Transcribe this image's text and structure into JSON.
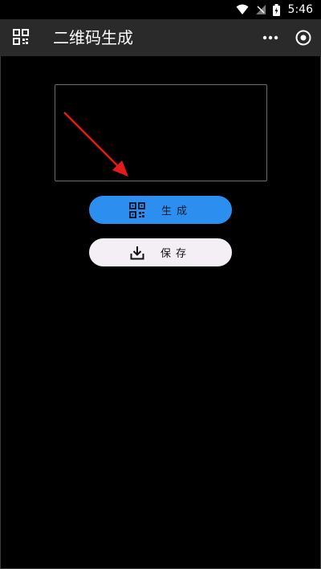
{
  "status_bar": {
    "time": "5:46",
    "icons": [
      "wifi-icon",
      "signal-off-icon",
      "battery-charging-icon"
    ]
  },
  "app_bar": {
    "title": "二维码生成",
    "left_icon": "qr-code-icon",
    "right_icons": [
      "more-icon",
      "close-circle-icon"
    ]
  },
  "main": {
    "input_value": "",
    "annotation": "arrow-pointing-to-input",
    "generate_button": {
      "label": "生成",
      "icon": "qr-code-icon",
      "color": "#2c8ff0"
    },
    "save_button": {
      "label": "保存",
      "icon": "download-icon",
      "color": "#f3eff5"
    }
  },
  "colors": {
    "background": "#000000",
    "app_bar": "#2a2a2a",
    "arrow": "#e51a1a"
  }
}
